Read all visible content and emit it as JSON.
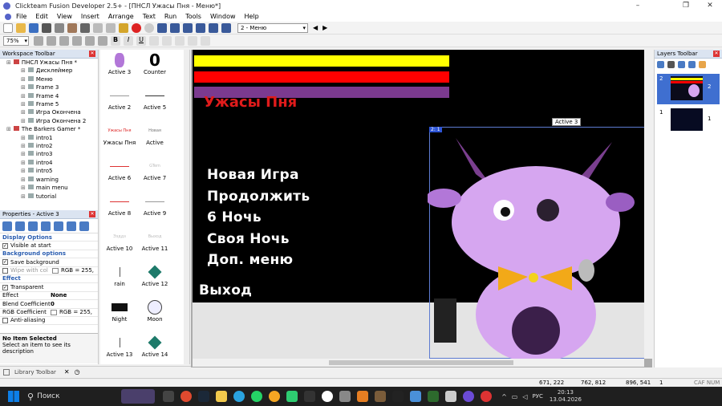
{
  "window": {
    "title": "Clickteam Fusion Developer 2.5+ - [ПНСЛ Ужасы Пня - Меню*]",
    "min": "–",
    "max": "❐",
    "close": "✕"
  },
  "menu": [
    "File",
    "Edit",
    "View",
    "Insert",
    "Arrange",
    "Text",
    "Run",
    "Tools",
    "Window",
    "Help"
  ],
  "toolbar2": {
    "zoom": "75%",
    "frame_select": "2 - Меню"
  },
  "workspace": {
    "title": "Workspace Toolbar",
    "items": [
      {
        "label": "ПНСЛ Ужасы Пня *",
        "level": 0
      },
      {
        "label": "Дисклеймер",
        "level": 1
      },
      {
        "label": "Меню",
        "level": 1
      },
      {
        "label": "Frame 3",
        "level": 1
      },
      {
        "label": "Frame 4",
        "level": 1
      },
      {
        "label": "Frame 5",
        "level": 1
      },
      {
        "label": "Игра Окончена",
        "level": 1
      },
      {
        "label": "Игра Окончена 2",
        "level": 1
      },
      {
        "label": "The Barkers Gamer *",
        "level": 0
      },
      {
        "label": "intro1",
        "level": 1
      },
      {
        "label": "intro2",
        "level": 1
      },
      {
        "label": "intro3",
        "level": 1
      },
      {
        "label": "intro4",
        "level": 1
      },
      {
        "label": "intro5",
        "level": 1
      },
      {
        "label": "warning",
        "level": 1
      },
      {
        "label": "main menu",
        "level": 1
      },
      {
        "label": "tutorial",
        "level": 1
      }
    ]
  },
  "properties": {
    "title": "Properties - Active 3",
    "rows": [
      {
        "type": "cat",
        "label": "Display Options"
      },
      {
        "type": "check",
        "label": "Visible at start",
        "checked": true
      },
      {
        "type": "cat",
        "label": "Background options"
      },
      {
        "type": "check",
        "label": "Save background",
        "checked": true
      },
      {
        "type": "checkval",
        "label": "Wipe with col",
        "checked": false,
        "value": "RGB = 255,"
      },
      {
        "type": "cat",
        "label": "Effect"
      },
      {
        "type": "check",
        "label": "Transparent",
        "checked": true
      },
      {
        "type": "kv",
        "label": "Effect",
        "value": "None"
      },
      {
        "type": "kv",
        "label": "Blend Coefficient",
        "value": "0"
      },
      {
        "type": "kv",
        "label": "RGB Coefficient",
        "value": "RGB = 255,"
      },
      {
        "type": "check",
        "label": "Anti-aliasing",
        "checked": false
      }
    ],
    "no_item": "No Item Selected",
    "no_item_desc": "Select an item to see its description"
  },
  "library": {
    "label": "Library Toolbar"
  },
  "objects": [
    {
      "label": "Active 3",
      "icon": "luntik"
    },
    {
      "label": "Counter",
      "icon": "counter",
      "glyph": "0"
    },
    {
      "label": "Active 2",
      "icon": "line-gray"
    },
    {
      "label": "Active 5",
      "icon": "line-dark"
    },
    {
      "label": "Ужасы Пня",
      "icon": "red-text",
      "glyph": "Ужасы Пня"
    },
    {
      "label": "Active",
      "icon": "small-text",
      "glyph": "Новая"
    },
    {
      "label": "Active 6",
      "icon": "line-red"
    },
    {
      "label": "Active 7",
      "icon": "faint-text",
      "glyph": "GTem"
    },
    {
      "label": "Active 8",
      "icon": "line-red"
    },
    {
      "label": "Active 9",
      "icon": "line-gray"
    },
    {
      "label": "Active 10",
      "icon": "faint-text",
      "glyph": "Эзддз"
    },
    {
      "label": "Active 11",
      "icon": "faint-text",
      "glyph": "Выход"
    },
    {
      "label": "rain",
      "icon": "rain"
    },
    {
      "label": "Active 12",
      "icon": "diamond"
    },
    {
      "label": "Night",
      "icon": "night"
    },
    {
      "label": "Moon",
      "icon": "moon"
    },
    {
      "label": "Active 13",
      "icon": "rain"
    },
    {
      "label": "Active 14",
      "icon": "diamond"
    }
  ],
  "frame": {
    "title_text": "Ужасы Пня",
    "menu_items": [
      "Новая Игра",
      "Продолжить",
      "6 Ночь",
      "Своя Ночь",
      "Доп. меню"
    ],
    "exit": "Выход",
    "selected_label": "Active 3",
    "handle_label": "2: 1",
    "bars": [
      {
        "color": "#ffff00"
      },
      {
        "color": "#ff0000"
      },
      {
        "color": "#7b3a8f"
      }
    ]
  },
  "layers": {
    "title": "Layers Toolbar",
    "items": [
      {
        "num": "2",
        "index": "2"
      },
      {
        "num": "1",
        "index": "1"
      }
    ]
  },
  "status": {
    "coords1": "671, 222",
    "coords2": "762, 812",
    "coords3": "896, 541",
    "layer": "1",
    "keys": "CAF NUM"
  },
  "taskbar": {
    "search": "Поиск",
    "lang": "РУС",
    "time": "20:13",
    "date": "13.04.2026"
  }
}
